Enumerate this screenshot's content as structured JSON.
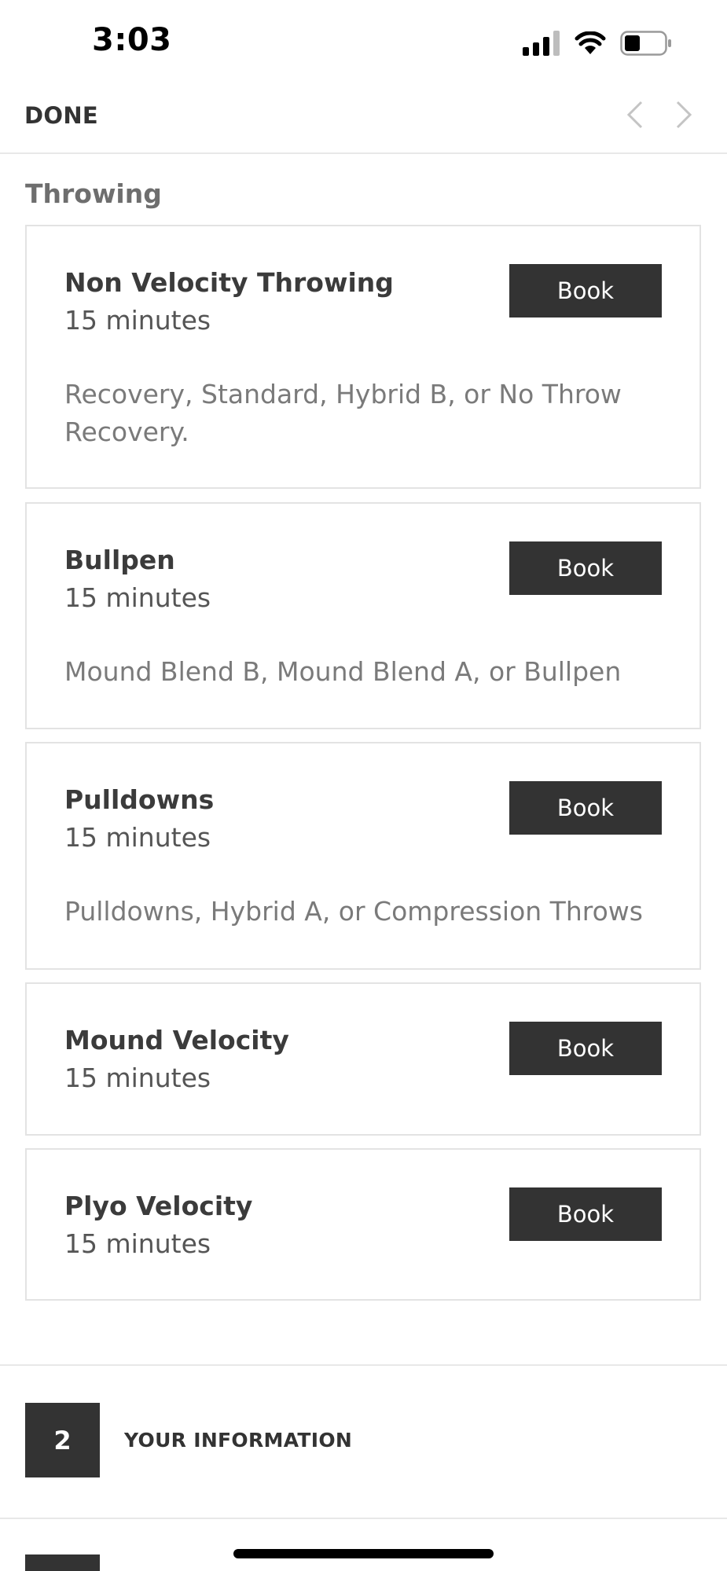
{
  "status_bar": {
    "time": "3:03"
  },
  "nav": {
    "done_label": "DONE"
  },
  "section": {
    "title": "Throwing"
  },
  "services": [
    {
      "title": "Non Velocity Throwing",
      "duration": "15 minutes",
      "description": "Recovery, Standard, Hybrid B, or No Throw Recovery.",
      "button": "Book"
    },
    {
      "title": "Bullpen",
      "duration": "15 minutes",
      "description": "Mound Blend B, Mound Blend A, or Bullpen",
      "button": "Book"
    },
    {
      "title": "Pulldowns",
      "duration": "15 minutes",
      "description": "Pulldowns, Hybrid A, or Compression Throws",
      "button": "Book"
    },
    {
      "title": "Mound Velocity",
      "duration": "15 minutes",
      "description": "",
      "button": "Book"
    },
    {
      "title": "Plyo Velocity",
      "duration": "15 minutes",
      "description": "",
      "button": "Book"
    }
  ],
  "steps": [
    {
      "number": "2",
      "label": "YOUR INFORMATION"
    }
  ],
  "icons": [
    "signal-icon",
    "wifi-icon",
    "battery-icon",
    "chevron-left-icon",
    "chevron-right-icon"
  ],
  "colors": {
    "button_bg": "#333333",
    "border": "#e3e3e3",
    "muted_text": "#7a7a7a"
  }
}
